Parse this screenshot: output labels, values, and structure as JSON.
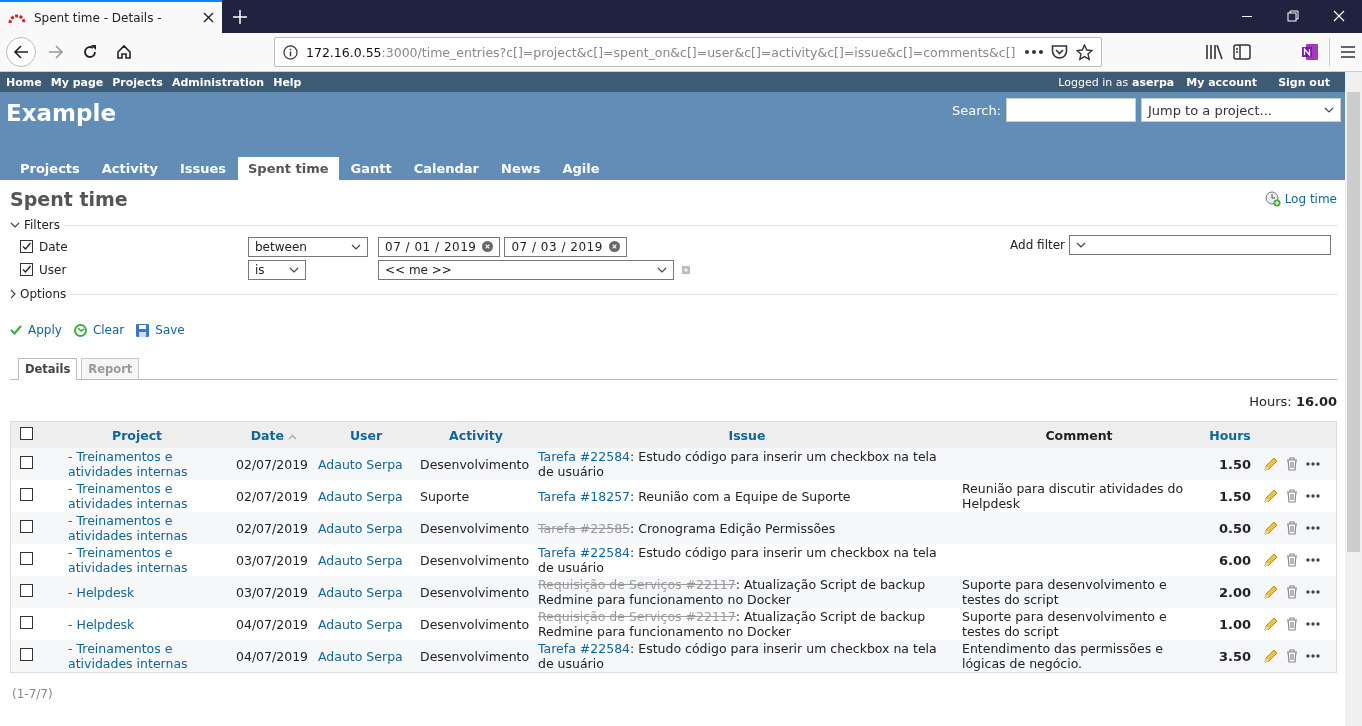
{
  "browser": {
    "tab_title": "Spent time - Details -",
    "url_host": "172.16.0.55",
    "url_path": ":3000/time_entries?c[]=project&c[]=spent_on&c[]=user&c[]=activity&c[]=issue&c[]=comments&c[]"
  },
  "top_menu": [
    "Home",
    "My page",
    "Projects",
    "Administration",
    "Help"
  ],
  "account": {
    "logged_in_as": "Logged in as",
    "user": "aserpa",
    "links": [
      "My account",
      "Sign out"
    ]
  },
  "header": {
    "title": "Example",
    "search_label": "Search:",
    "jump_placeholder": "Jump to a project..."
  },
  "main_menu": [
    {
      "label": "Projects",
      "selected": false
    },
    {
      "label": "Activity",
      "selected": false
    },
    {
      "label": "Issues",
      "selected": false
    },
    {
      "label": "Spent time",
      "selected": true
    },
    {
      "label": "Gantt",
      "selected": false
    },
    {
      "label": "Calendar",
      "selected": false
    },
    {
      "label": "News",
      "selected": false
    },
    {
      "label": "Agile",
      "selected": false
    }
  ],
  "page_title": "Spent time",
  "log_time": "Log time",
  "filters": {
    "legend": "Filters",
    "rows": [
      {
        "label": "Date",
        "checked": true,
        "operator": "between",
        "values": [
          "07 / 01 / 2019",
          "07 / 03 / 2019"
        ]
      },
      {
        "label": "User",
        "checked": true,
        "operator": "is",
        "select": "<< me >>"
      }
    ],
    "add_filter": "Add filter",
    "options": "Options"
  },
  "actions": [
    "Apply",
    "Clear",
    "Save"
  ],
  "tabs": [
    {
      "label": "Details",
      "selected": true
    },
    {
      "label": "Report",
      "selected": false
    }
  ],
  "total": {
    "label": "Hours:",
    "value": "16.00"
  },
  "table": {
    "select_all": {
      "checked": false
    },
    "columns": [
      "Project",
      "Date",
      "User",
      "Activity",
      "Issue",
      "Comment",
      "Hours"
    ],
    "rows": [
      {
        "checked": false,
        "project": "- Treinamentos e atividades internas",
        "date": "02/07/2019",
        "user": "Adauto Serpa",
        "activity": "Desenvolvimento",
        "issue": "Tarefa #22584",
        "closed": false,
        "subject": ": Estudo código para inserir um checkbox na tela de usuário",
        "comment": "",
        "hours": "1.50"
      },
      {
        "checked": false,
        "project": "- Treinamentos e atividades internas",
        "date": "02/07/2019",
        "user": "Adauto Serpa",
        "activity": "Suporte",
        "issue": "Tarefa #18257",
        "closed": false,
        "subject": ": Reunião com a Equipe de Suporte",
        "comment": "Reunião para discutir atividades do Helpdesk",
        "hours": "1.50"
      },
      {
        "checked": false,
        "project": "- Treinamentos e atividades internas",
        "date": "02/07/2019",
        "user": "Adauto Serpa",
        "activity": "Desenvolvimento",
        "issue": "Tarefa #22585",
        "closed": true,
        "subject": ": Cronograma Edição Permissões",
        "comment": "",
        "hours": "0.50"
      },
      {
        "checked": false,
        "project": "- Treinamentos e atividades internas",
        "date": "03/07/2019",
        "user": "Adauto Serpa",
        "activity": "Desenvolvimento",
        "issue": "Tarefa #22584",
        "closed": false,
        "subject": ": Estudo código para inserir um checkbox na tela de usuário",
        "comment": "",
        "hours": "6.00"
      },
      {
        "checked": false,
        "project": "- Helpdesk",
        "date": "03/07/2019",
        "user": "Adauto Serpa",
        "activity": "Desenvolvimento",
        "issue": "Requisição de Serviços #22117",
        "closed": true,
        "subject": ": Atualização Script de backup Redmine para funcionamento no Docker",
        "comment": "Suporte para desenvolvimento e testes do script",
        "hours": "2.00"
      },
      {
        "checked": false,
        "project": "- Helpdesk",
        "date": "04/07/2019",
        "user": "Adauto Serpa",
        "activity": "Desenvolvimento",
        "issue": "Requisição de Serviços #22117",
        "closed": true,
        "subject": ": Atualização Script de backup Redmine para funcionamento no Docker",
        "comment": "Suporte para desenvolvimento e testes do script",
        "hours": "1.00"
      },
      {
        "checked": false,
        "project": "- Treinamentos e atividades internas",
        "date": "04/07/2019",
        "user": "Adauto Serpa",
        "activity": "Desenvolvimento",
        "issue": "Tarefa #22584",
        "closed": false,
        "subject": ": Estudo código para inserir um checkbox na tela de usuário",
        "comment": "Entendimento das permissões e lógicas de negócio.",
        "hours": "3.50"
      }
    ]
  },
  "pagination": "(1-7/7)"
}
